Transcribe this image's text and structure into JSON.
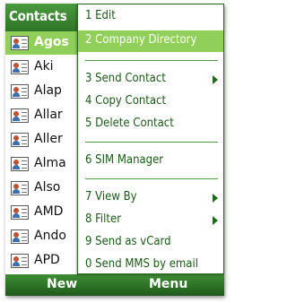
{
  "title_bar": {
    "title": "Contacts"
  },
  "contacts": [
    {
      "name": "Agos",
      "selected": true
    },
    {
      "name": "Aki",
      "selected": false
    },
    {
      "name": "Alap",
      "selected": false
    },
    {
      "name": "Allar",
      "selected": false
    },
    {
      "name": "Aller",
      "selected": false
    },
    {
      "name": "Alma",
      "selected": false
    },
    {
      "name": "Also",
      "selected": false
    },
    {
      "name": "AMD",
      "selected": false
    },
    {
      "name": "Ando",
      "selected": false
    },
    {
      "name": "APD",
      "selected": false
    }
  ],
  "menu": {
    "items": [
      {
        "label": "1 Edit",
        "submenu": false,
        "highlighted": false
      },
      {
        "label": "2 Company Directory",
        "submenu": false,
        "highlighted": true
      },
      {
        "label": "3 Send Contact",
        "submenu": true,
        "highlighted": false
      },
      {
        "label": "4 Copy Contact",
        "submenu": false,
        "highlighted": false
      },
      {
        "label": "5 Delete Contact",
        "submenu": false,
        "highlighted": false
      },
      {
        "label": "6 SIM Manager",
        "submenu": false,
        "highlighted": false
      },
      {
        "label": "7 View By",
        "submenu": true,
        "highlighted": false
      },
      {
        "label": "8 Filter",
        "submenu": true,
        "highlighted": false
      },
      {
        "label": "9 Send as vCard",
        "submenu": false,
        "highlighted": false
      },
      {
        "label": "0 Send MMS by email",
        "submenu": false,
        "highlighted": false
      }
    ]
  },
  "softkeys": {
    "left": "New",
    "right": "Menu"
  },
  "colors": {
    "accent": "#2f7427",
    "highlight": "#8fcf5a",
    "menu_text": "#1b5a17"
  }
}
